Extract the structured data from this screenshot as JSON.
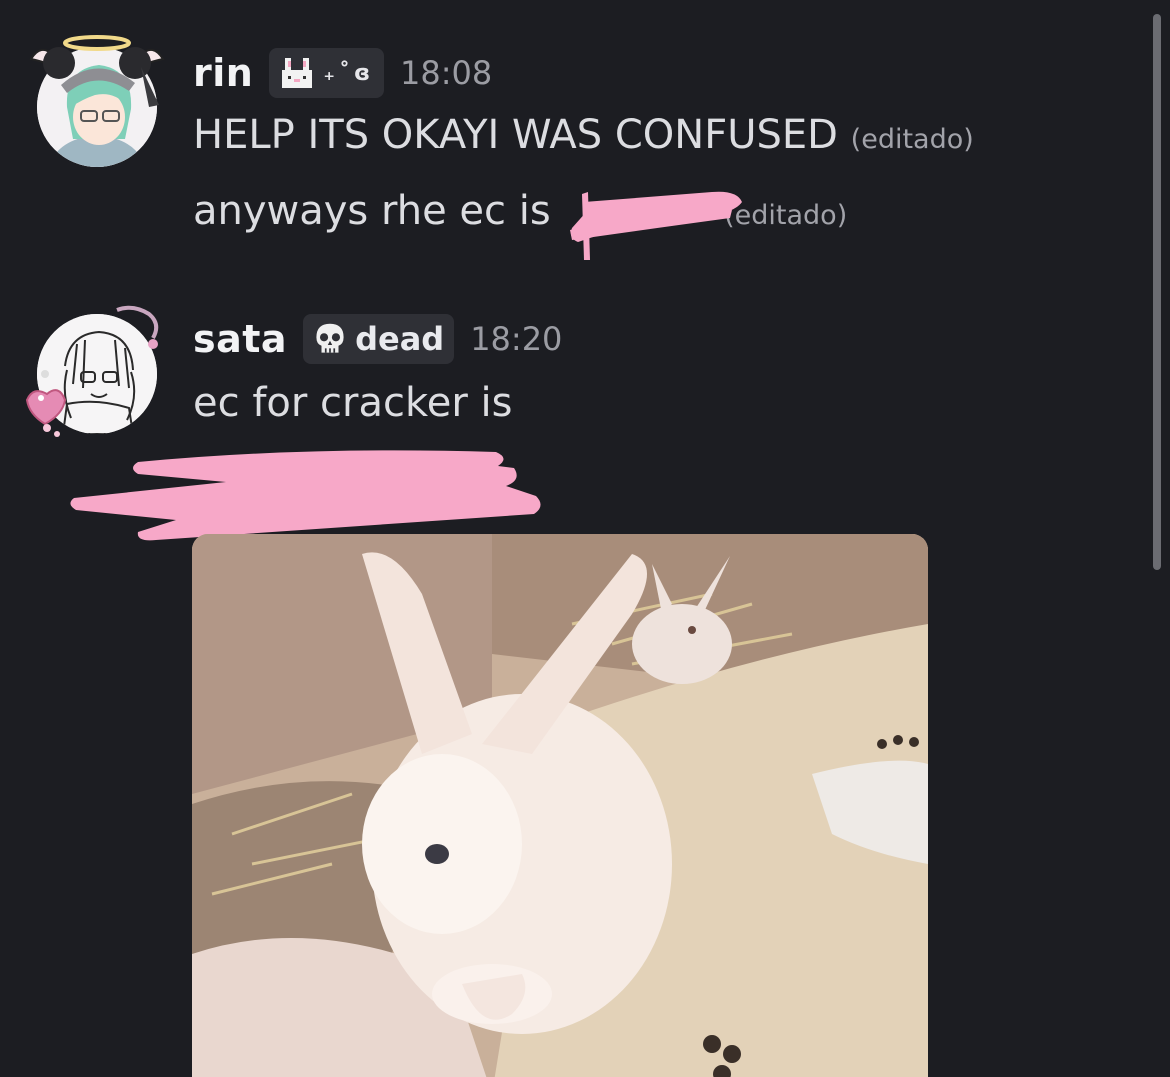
{
  "colors": {
    "background": "#1c1d22",
    "tag_background": "#2f3036",
    "redaction_pink": "#f7a8c8",
    "username": "#f2f3f5",
    "text": "#dcdde1",
    "muted": "#9b9ca3"
  },
  "messages": [
    {
      "username": "rin",
      "tag_icon": "pixel-bunny-icon",
      "tag_glyphs": "₊˚ɞ",
      "timestamp": "18:08",
      "avatar": "anime-avatar-halo",
      "lines": [
        {
          "text": "HELP ITS OKAYI WAS CONFUSED",
          "edited": "(editado)"
        },
        {
          "text": "anyways rhe ec is",
          "edited": "(editado)",
          "redacted": true
        }
      ]
    },
    {
      "username": "sata",
      "tag_icon": "skull-icon",
      "tag_label": "dead",
      "timestamp": "18:20",
      "avatar": "sketch-avatar-hearts",
      "lines": [
        {
          "text": "ec for cracker is",
          "redacted_below": true
        }
      ],
      "attachment": {
        "type": "image",
        "description": "bunny-gif"
      }
    }
  ]
}
